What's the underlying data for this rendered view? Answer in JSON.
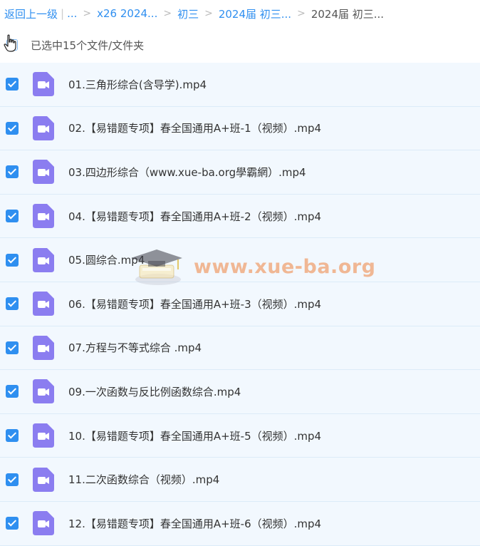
{
  "breadcrumb": {
    "back": "返回上一级",
    "ellipsis": "...",
    "items": [
      "x26 2024...",
      "初三",
      "2024届 初三..."
    ],
    "current": "2024届 初三..."
  },
  "selection": {
    "text": "已选中15个文件/文件夹"
  },
  "files": [
    {
      "name": "01.三角形综合(含导学).mp4"
    },
    {
      "name": "02.【易错题专项】春全国通用A+班-1（视频）.mp4"
    },
    {
      "name": "03.四边形综合（www.xue-ba.org學霸網）.mp4"
    },
    {
      "name": "04.【易错题专项】春全国通用A+班-2（视频）.mp4"
    },
    {
      "name": "05.圆综合.mp4"
    },
    {
      "name": "06.【易错题专项】春全国通用A+班-3（视频）.mp4"
    },
    {
      "name": "07.方程与不等式综合 .mp4"
    },
    {
      "name": "09.一次函数与反比例函数综合.mp4"
    },
    {
      "name": "10.【易错题专项】春全国通用A+班-5（视频）.mp4"
    },
    {
      "name": "11.二次函数综合（视频）.mp4"
    },
    {
      "name": "12.【易错题专项】春全国通用A+班-6（视频）.mp4"
    }
  ],
  "watermark": {
    "text": "www.xue-ba.org"
  },
  "colors": {
    "accent": "#2f8ff0",
    "video_icon": "#8b7df0",
    "row_bg": "#f2f8fe"
  }
}
